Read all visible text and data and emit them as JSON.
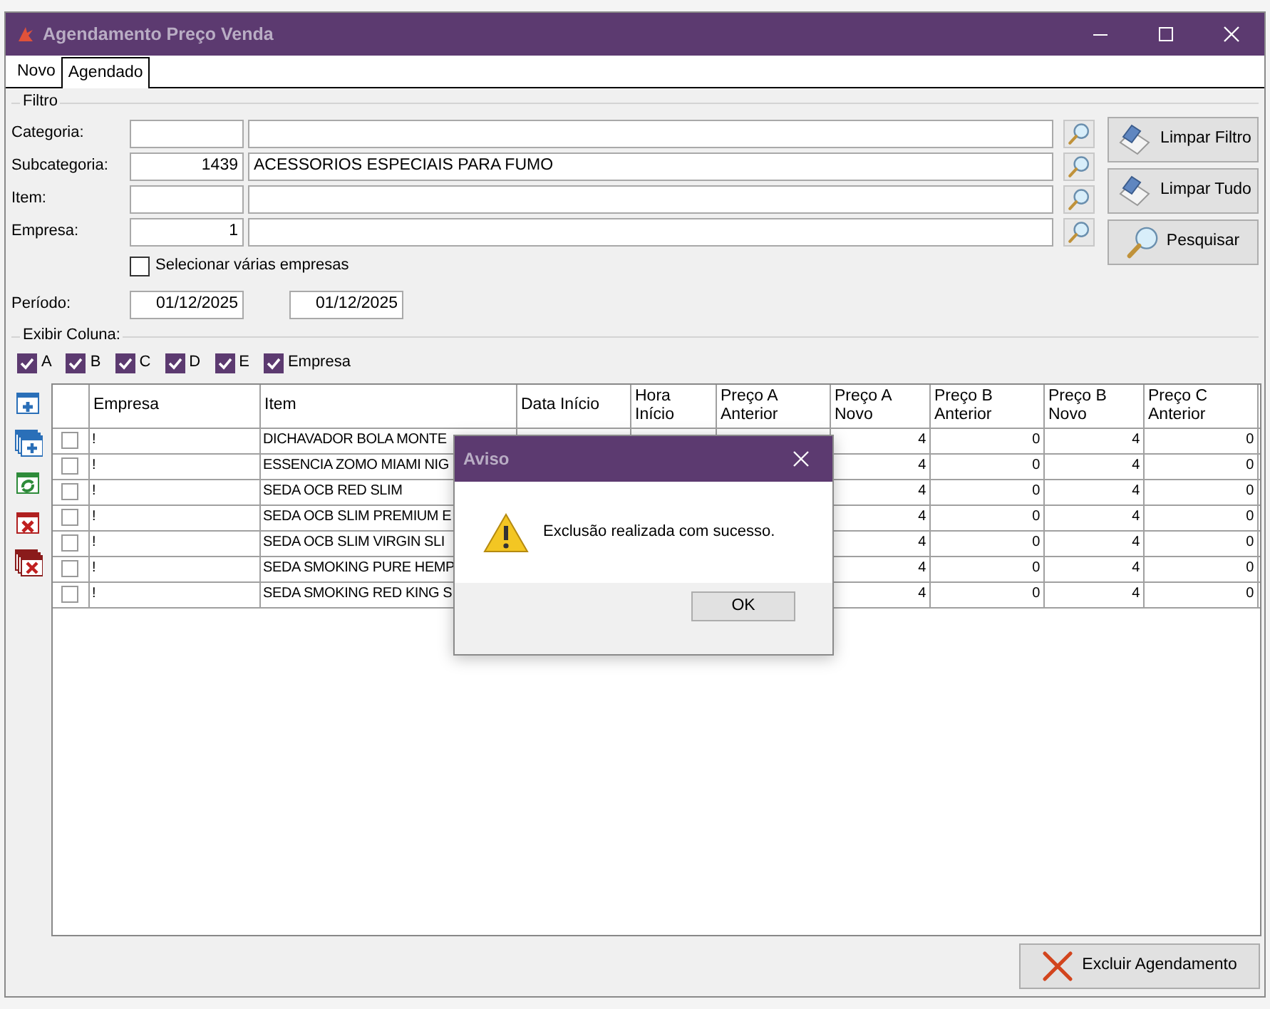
{
  "window": {
    "title": "Agendamento Preço Venda"
  },
  "tabs": [
    {
      "label": "Novo",
      "selected": false
    },
    {
      "label": "Agendado",
      "selected": true
    }
  ],
  "filter": {
    "title": "Filtro",
    "fields": [
      {
        "label": "Categoria:"
      },
      {
        "label": "Subcategoria:",
        "code": "1439",
        "description": "ACESSORIOS ESPECIAIS PARA FUMO"
      },
      {
        "label": "Item:"
      },
      {
        "label": "Empresa:",
        "code": "1"
      }
    ],
    "multi_company": {
      "label": "Selecionar várias empresas",
      "checked": false
    },
    "period": {
      "label": "Período:",
      "start": "01/12/2025",
      "end": "01/12/2025"
    },
    "buttons": [
      {
        "label": "Limpar Filtro",
        "kind": "eraser"
      },
      {
        "label": "Limpar Tudo",
        "kind": "eraser"
      },
      {
        "label": "Pesquisar",
        "kind": "search"
      }
    ]
  },
  "column_toggles": {
    "title": "Exibir Coluna:",
    "items": [
      {
        "label": "A",
        "checked": true
      },
      {
        "label": "B",
        "checked": true
      },
      {
        "label": "C",
        "checked": true
      },
      {
        "label": "D",
        "checked": true
      },
      {
        "label": "E",
        "checked": true
      },
      {
        "label": "Empresa",
        "checked": true
      }
    ]
  },
  "table": {
    "columns": [
      "Empresa",
      "Item",
      "Data Início",
      "Hora Início",
      "Preço A Anterior",
      "Preço A Novo",
      "Preço B Anterior",
      "Preço B Novo",
      "Preço C Anterior"
    ],
    "rows": [
      {
        "checked": false,
        "cells": [
          "!",
          "DICHAVADOR BOLA MONTE",
          null,
          null,
          null,
          "4",
          "0",
          "4",
          "0"
        ]
      },
      {
        "checked": false,
        "cells": [
          "!",
          "ESSENCIA ZOMO MIAMI NIG",
          null,
          null,
          null,
          "4",
          "0",
          "4",
          "0"
        ]
      },
      {
        "checked": false,
        "cells": [
          "!",
          "SEDA OCB RED SLIM",
          null,
          null,
          null,
          "4",
          "0",
          "4",
          "0"
        ]
      },
      {
        "checked": false,
        "cells": [
          "!",
          "SEDA OCB SLIM PREMIUM E",
          null,
          null,
          null,
          "4",
          "0",
          "4",
          "0"
        ]
      },
      {
        "checked": false,
        "cells": [
          "!",
          "SEDA OCB SLIM VIRGIN SLI",
          null,
          null,
          null,
          "4",
          "0",
          "4",
          "0"
        ]
      },
      {
        "checked": false,
        "cells": [
          "!",
          "SEDA SMOKING PURE HEMP",
          null,
          null,
          null,
          "4",
          "0",
          "4",
          "0"
        ]
      },
      {
        "checked": false,
        "cells": [
          "!",
          "SEDA SMOKING RED KING S",
          null,
          null,
          null,
          "4",
          "0",
          "4",
          "0"
        ]
      }
    ]
  },
  "dialog": {
    "title": "Aviso",
    "message": "Exclusão realizada com sucesso.",
    "button": "OK"
  },
  "footer": {
    "button": "Excluir Agendamento"
  }
}
